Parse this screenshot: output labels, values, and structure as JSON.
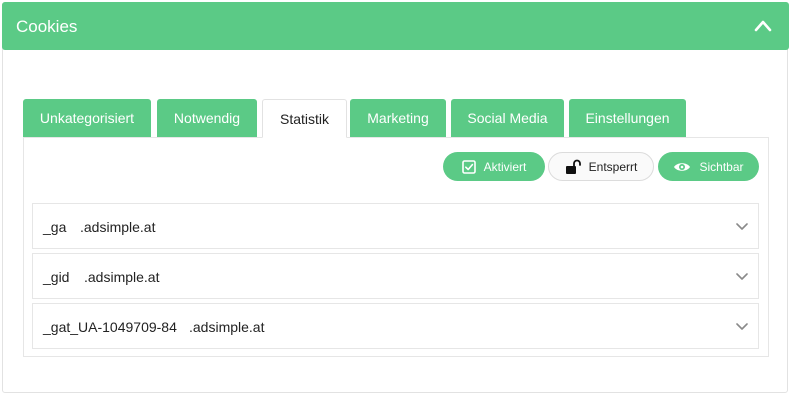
{
  "header": {
    "title": "Cookies"
  },
  "tabs": [
    {
      "label": "Unkategorisiert",
      "active": false
    },
    {
      "label": "Notwendig",
      "active": false
    },
    {
      "label": "Statistik",
      "active": true
    },
    {
      "label": "Marketing",
      "active": false
    },
    {
      "label": "Social Media",
      "active": false
    },
    {
      "label": "Einstellungen",
      "active": false
    }
  ],
  "badges": {
    "activated": {
      "label": "Aktiviert",
      "icon": "checkbox-icon"
    },
    "unlocked": {
      "label": "Entsperrt",
      "icon": "unlock-icon"
    },
    "visible": {
      "label": "Sichtbar",
      "icon": "eye-icon"
    }
  },
  "cookies": [
    {
      "name": "_ga",
      "domain": ".adsimple.at"
    },
    {
      "name": "_gid",
      "domain": ".adsimple.at"
    },
    {
      "name": "_gat_UA-1049709-84",
      "domain": ".adsimple.at"
    }
  ],
  "colors": {
    "accent": "#5bca86",
    "border": "#e6e6e6"
  }
}
